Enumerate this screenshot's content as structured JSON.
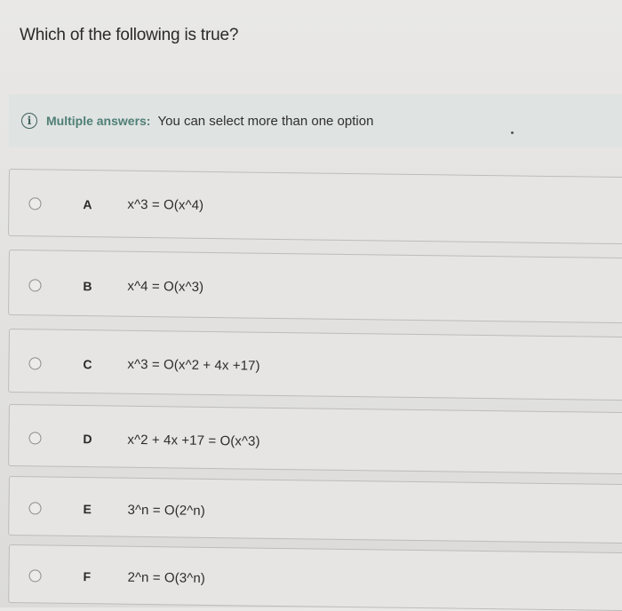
{
  "question": "Which of the following is true?",
  "info": {
    "label": "Multiple answers:",
    "text": "You can select more than one option"
  },
  "options": [
    {
      "letter": "A",
      "text": "x^3 = O(x^4)"
    },
    {
      "letter": "B",
      "text": "x^4 = O(x^3)"
    },
    {
      "letter": "C",
      "text": "x^3 = O(x^2 + 4x +17)"
    },
    {
      "letter": "D",
      "text": "x^2 + 4x +17 = O(x^3)"
    },
    {
      "letter": "E",
      "text": "3^n = O(2^n)"
    },
    {
      "letter": "F",
      "text": "2^n = O(3^n)"
    }
  ]
}
